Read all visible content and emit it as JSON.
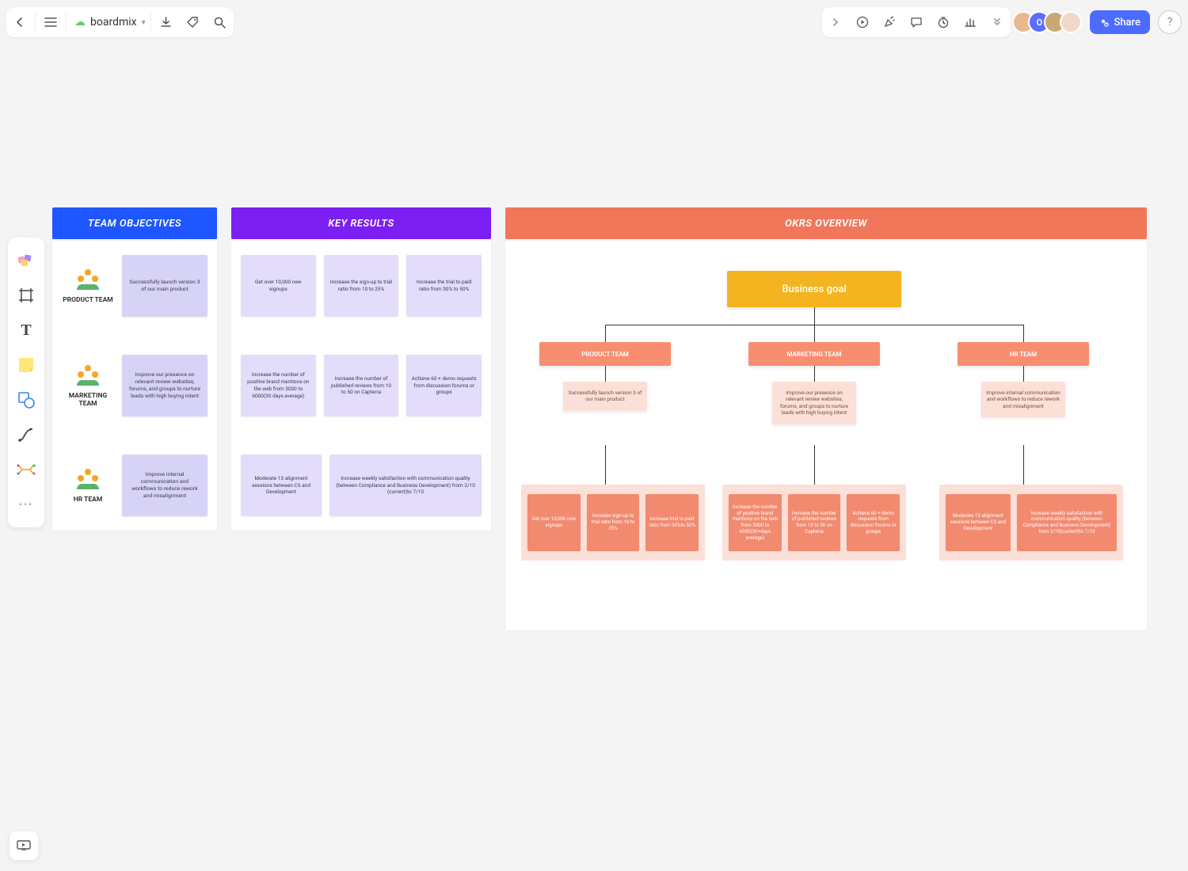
{
  "app_title": "boardmix",
  "share_label": "Share",
  "headers": {
    "obj": "TEAM OBJECTIVES",
    "kr": "KEY RESULTS",
    "ov": "OKRS OVERVIEW"
  },
  "teams": [
    {
      "name": "PRODUCT TEAM",
      "objective": "Successfully launch version 3 of our main product",
      "krs": [
        "Get over 10,000 new signups",
        "Increase the sign-up to trial ratio from 10 to 25%",
        "Increase the trial to paid ratio from 30% to 50%"
      ]
    },
    {
      "name": "MARKETING TEAM",
      "objective": "Improve our presence on relevant review websites, forums, and groups to nurture leads with high buying intent",
      "krs": [
        "Increase the number of positive brand mentions on the web from 3000 to 6000(30 days average)",
        "Increase the number of published reviews from 10 to 50 on Capterra",
        "Achieve 60 + demo requests from discussion forums or groups"
      ]
    },
    {
      "name": "HR TEAM",
      "objective": "Improve internal communication and workflows to reduce rework and misalignment",
      "krs": [
        "Moderate 13 alignment sessions between CS and Development",
        "Increase weekly satisfaction with communication quality (between Compliance and Business Development) from 2/10 (current)to 7/10"
      ]
    }
  ],
  "overview": {
    "goal": "Business goal",
    "team_labels": [
      "PRODUCT TEAM",
      "MARKETING TEAM",
      "HR TEAM"
    ],
    "mids": [
      "Successfully launch version 3 of our main product",
      "Improve our presence on relevant review websites, forums, and groups to nurture leads with high buying intent",
      "Improve internal communication and workflows to reduce rework and misalignment"
    ],
    "blocks": [
      [
        "Get over 10,000 new signups",
        "Increase sign-up to trial ratio from 10 to 25%",
        "Increase trial to paid ratio from 30%to 50%"
      ],
      [
        "Increase the number of positive brand mentions on the web from 3000 to 6000(30+days average)",
        "Increase the number of published reviews from 10 to 50 on Capterra",
        "Achieve 60 + demo requests from discussion forums or groups"
      ],
      [
        "Moderate 13 alignment sessions between CS and Development",
        "Increase weekly satisfaction with communication quality (between Compliance and Business Development) from 2/10(current)to 7/10"
      ]
    ]
  }
}
